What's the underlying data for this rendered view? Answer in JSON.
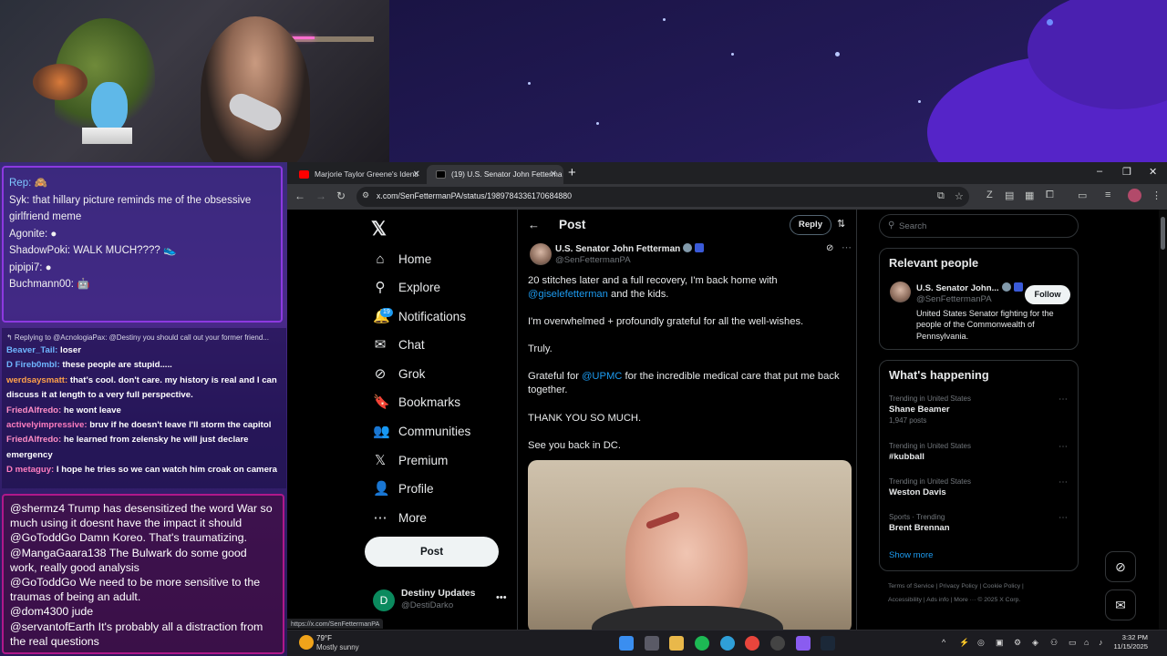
{
  "stream": {
    "top_chat": [
      {
        "user": "Rep:",
        "text": "🙈"
      },
      {
        "user": "Syk:",
        "text": "that hillary picture reminds me of the obsessive girlfriend meme"
      },
      {
        "user": "Agonite:",
        "text": "●"
      },
      {
        "user": "ShadowPoki:",
        "text": "WALK MUCH???? 👟"
      },
      {
        "user": "pipipi7:",
        "text": "●"
      },
      {
        "user": "Buchmann00:",
        "text": "🤖"
      }
    ],
    "mid_chat": {
      "reply_header": "↰ Replying to @AcnologiaPax: @Destiny you should call out your former friend...",
      "lines": [
        {
          "user": "Beaver_Tail:",
          "text": "loser"
        },
        {
          "user": "D Fireb0mbl:",
          "text": "these people are stupid....."
        },
        {
          "user": "werdsaysmatt:",
          "text": "that's cool. don't care. my history is real and I can discuss it at length to a very full perspective."
        },
        {
          "user": "FriedAlfredo:",
          "text": "he wont leave"
        },
        {
          "user": "activelyimpressive:",
          "text": "bruv if he doesn't leave I'll storm the capitol"
        },
        {
          "user": "FriedAlfredo:",
          "text": "he learned from zelensky he will just declare emergency"
        },
        {
          "user": "D metaguy:",
          "text": "I hope he tries so we can watch him croak on camera"
        }
      ]
    },
    "bottom_chat": [
      {
        "user": "@shermz4",
        "text": "Trump has desensitized the word War so much using it doesnt have the impact it should"
      },
      {
        "user": "@GoToddGo",
        "text": "Damn Koreo. That's traumatizing."
      },
      {
        "user": "@MangaGaara138",
        "text": "The Bulwark do some good work, really good analysis"
      },
      {
        "user": "@GoToddGo",
        "text": "We need to be more sensitive to the traumas of being an adult."
      },
      {
        "user": "@dom4300",
        "text": "jude"
      },
      {
        "user": "@servantofEarth",
        "text": "It's probably all a distraction from the real questions"
      }
    ]
  },
  "browser": {
    "tabs": [
      {
        "title": "Marjorie Taylor Greene's Identi",
        "close": "✕"
      },
      {
        "title": "(19) U.S. Senator John Fetterma",
        "close": "✕"
      }
    ],
    "new_tab": "+",
    "window_controls": {
      "minimize": "–",
      "maximize": "❐",
      "close": "✕"
    },
    "url": "x.com/SenFettermanPA/status/1989784336170684880",
    "status_url": "https://x.com/SenFettermanPA"
  },
  "x": {
    "logo": "𝕏",
    "nav": [
      {
        "label": "Home",
        "icon": "home-icon",
        "glyph": "⌂"
      },
      {
        "label": "Explore",
        "icon": "search-icon",
        "glyph": "⚲"
      },
      {
        "label": "Notifications",
        "icon": "bell-icon",
        "glyph": "🔔",
        "badge": "19"
      },
      {
        "label": "Chat",
        "icon": "mail-icon",
        "glyph": "✉"
      },
      {
        "label": "Grok",
        "icon": "grok-icon",
        "glyph": "⊘"
      },
      {
        "label": "Bookmarks",
        "icon": "bookmark-icon",
        "glyph": "🔖"
      },
      {
        "label": "Communities",
        "icon": "communities-icon",
        "glyph": "👥"
      },
      {
        "label": "Premium",
        "icon": "x-premium-icon",
        "glyph": "𝕏"
      },
      {
        "label": "Profile",
        "icon": "person-icon",
        "glyph": "👤"
      },
      {
        "label": "More",
        "icon": "more-circle-icon",
        "glyph": "⋯"
      }
    ],
    "post_button": "Post",
    "account": {
      "name": "Destiny Updates",
      "handle": "@DestiDarko",
      "avatar": "D",
      "more": "•••"
    },
    "header": {
      "title": "Post",
      "back": "←",
      "reply_button": "Reply",
      "filter": "⇅"
    },
    "post": {
      "author": "U.S. Senator John Fetterman",
      "handle": "@SenFettermanPA",
      "p1_a": "20 stitches later and a full recovery, I'm back home with",
      "p1_mention": "@giselefetterman",
      "p1_b": " and the kids.",
      "p2": "I'm overwhelmed + profoundly grateful for all the well-wishes.",
      "p3": "Truly.",
      "p4_a": "Grateful for ",
      "p4_mention": "@UPMC",
      "p4_b": " for the incredible medical care that put me back together.",
      "p5": "THANK YOU SO MUCH.",
      "p6": "See you back in DC."
    },
    "search_placeholder": "Search",
    "relevant": {
      "title": "Relevant people",
      "name": "U.S. Senator John...",
      "handle": "@SenFettermanPA",
      "bio": "United States Senator fighting for the people of the Commonwealth of Pennsylvania.",
      "follow": "Follow"
    },
    "happening": {
      "title": "What's happening",
      "trends": [
        {
          "context": "Trending in United States",
          "name": "Shane Beamer",
          "count": "1,947 posts"
        },
        {
          "context": "Trending in United States",
          "name": "#kubball",
          "count": ""
        },
        {
          "context": "Trending in United States",
          "name": "Weston Davis",
          "count": ""
        },
        {
          "context": "Sports · Trending",
          "name": "Brent Brennan",
          "count": ""
        }
      ],
      "show_more": "Show more"
    },
    "footer": {
      "line1": "Terms of Service  |  Privacy Policy  |  Cookie Policy  |",
      "line2": "Accessibility  |  Ads info  |  More ···  © 2025 X Corp."
    }
  },
  "taskbar": {
    "temp": "79°F",
    "weather": "Mostly sunny",
    "time": "3:32 PM",
    "date": "11/15/2025"
  }
}
